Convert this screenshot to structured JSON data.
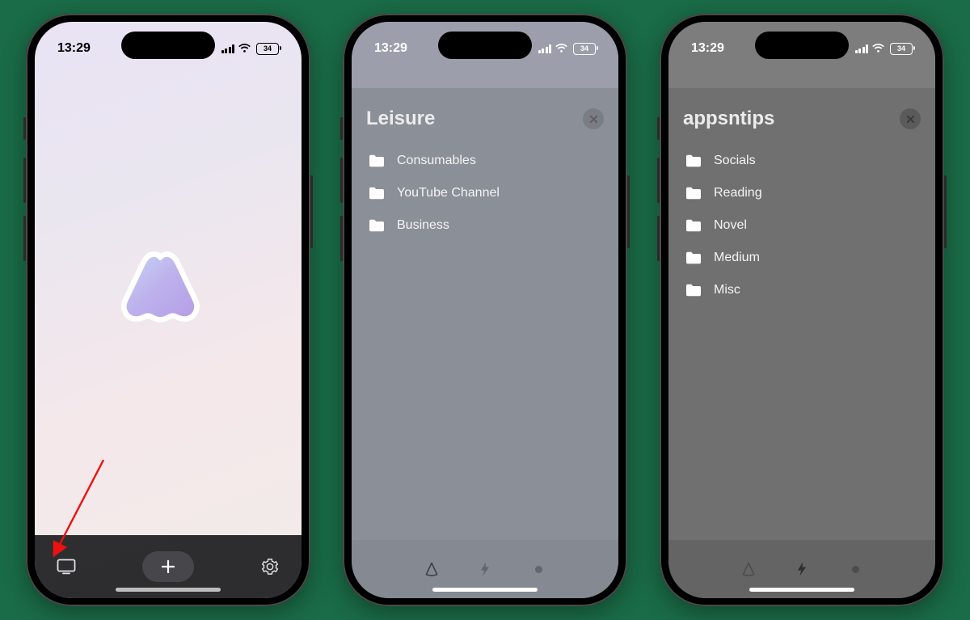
{
  "status": {
    "time": "13:29",
    "battery": "34"
  },
  "phone2": {
    "title": "Leisure",
    "items": [
      {
        "label": "Consumables"
      },
      {
        "label": "YouTube Channel"
      },
      {
        "label": "Business"
      }
    ]
  },
  "phone3": {
    "title": "appsntips",
    "items": [
      {
        "label": "Socials"
      },
      {
        "label": "Reading"
      },
      {
        "label": "Novel"
      },
      {
        "label": "Medium"
      },
      {
        "label": "Misc"
      }
    ]
  },
  "tabs": {
    "phone2_active": 0,
    "phone3_active": 1
  }
}
